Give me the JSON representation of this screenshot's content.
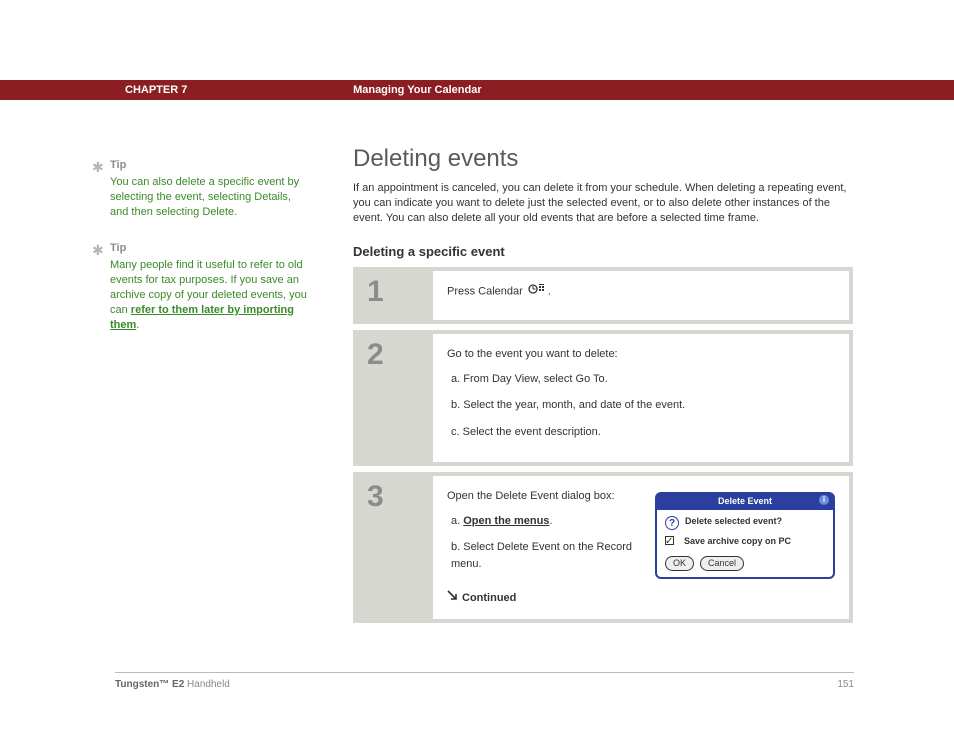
{
  "header": {
    "chapter": "CHAPTER 7",
    "title": "Managing Your Calendar"
  },
  "sidebar": {
    "tips": [
      {
        "label": "Tip",
        "body": "You can also delete a specific event by selecting the event, selecting Details, and then selecting Delete."
      },
      {
        "label": "Tip",
        "body_pre": "Many people find it useful to refer to old events for tax purposes. If you save an archive copy of your deleted events, you can ",
        "link": "refer to them later by importing them",
        "body_post": "."
      }
    ]
  },
  "main": {
    "h1": "Deleting events",
    "intro": "If an appointment is canceled, you can delete it from your schedule. When deleting a repeating event, you can indicate you want to delete just the selected event, or to also delete other instances of the event. You can also delete all your old events that are before a selected time frame.",
    "h2": "Deleting a specific event",
    "steps": {
      "s1": {
        "num": "1",
        "text_pre": "Press Calendar ",
        "text_post": "."
      },
      "s2": {
        "num": "2",
        "lead": "Go to the event you want to delete:",
        "a": "a.  From Day View, select Go To.",
        "b": "b.  Select the year, month, and date of the event.",
        "c": "c.  Select the event description."
      },
      "s3": {
        "num": "3",
        "lead": "Open the Delete Event dialog box:",
        "a_pre": "a.  ",
        "a_link": "Open the menus",
        "a_post": ".",
        "b": "b.  Select Delete Event on the Record menu.",
        "continued": "Continued"
      }
    },
    "dialog": {
      "title": "Delete Event",
      "question": "Delete selected event?",
      "checkbox": "Save archive copy on PC",
      "ok": "OK",
      "cancel": "Cancel"
    }
  },
  "footer": {
    "product_bold": "Tungsten™ E2",
    "product_rest": " Handheld",
    "page": "151"
  }
}
